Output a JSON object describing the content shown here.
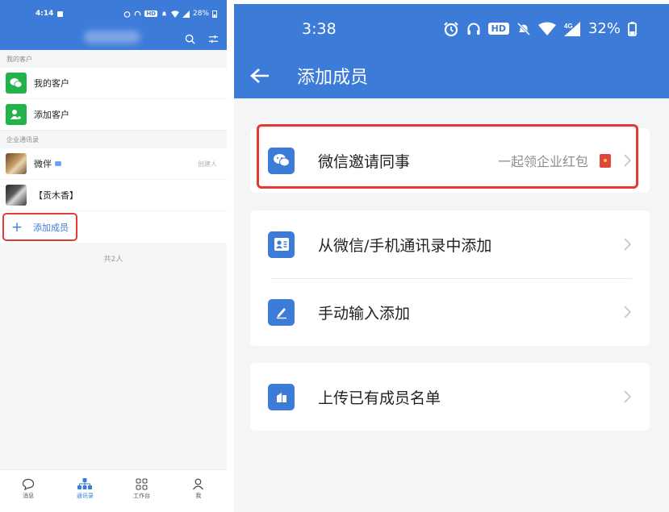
{
  "left": {
    "status": {
      "time": "4:14",
      "hd": "HD",
      "battery": "28%"
    },
    "sections": {
      "customers": "我的客户",
      "directory": "企业通讯录"
    },
    "customers": [
      {
        "label": "我的客户"
      },
      {
        "label": "添加客户"
      }
    ],
    "members": [
      {
        "name": "微伴",
        "note": "创建人"
      },
      {
        "name": "【贡木香】"
      }
    ],
    "add_member": "添加成员",
    "total": "共2人",
    "tabs": [
      {
        "label": "消息"
      },
      {
        "label": "通讯录"
      },
      {
        "label": "工作台"
      },
      {
        "label": "我"
      }
    ]
  },
  "right": {
    "status": {
      "time": "3:38",
      "hd": "HD",
      "net": "4G",
      "battery": "32%"
    },
    "title": "添加成员",
    "items": [
      {
        "label": "微信邀请同事",
        "note": "一起领企业红包"
      },
      {
        "label": "从微信/手机通讯录中添加"
      },
      {
        "label": "手动输入添加"
      },
      {
        "label": "上传已有成员名单"
      }
    ]
  },
  "colors": {
    "brand": "#3d7bd9",
    "highlight": "#e53935",
    "wechat_green": "#22b34a"
  }
}
